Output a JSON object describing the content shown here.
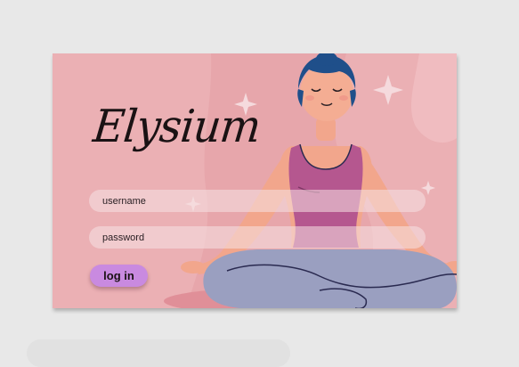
{
  "app": {
    "logo_text": "Elysium"
  },
  "form": {
    "username_placeholder": "username",
    "username_value": "",
    "password_placeholder": "password",
    "password_value": "",
    "login_label": "log in"
  },
  "colors": {
    "page_background": "#e8e8e8",
    "card_background": "#ebb0b4",
    "button": "#c98ae0",
    "hair": "#1f4f8a",
    "skin": "#f2a68c",
    "top": "#b5578f",
    "pants": "#9a9fc0"
  },
  "icons": [
    "sparkle-icon"
  ]
}
